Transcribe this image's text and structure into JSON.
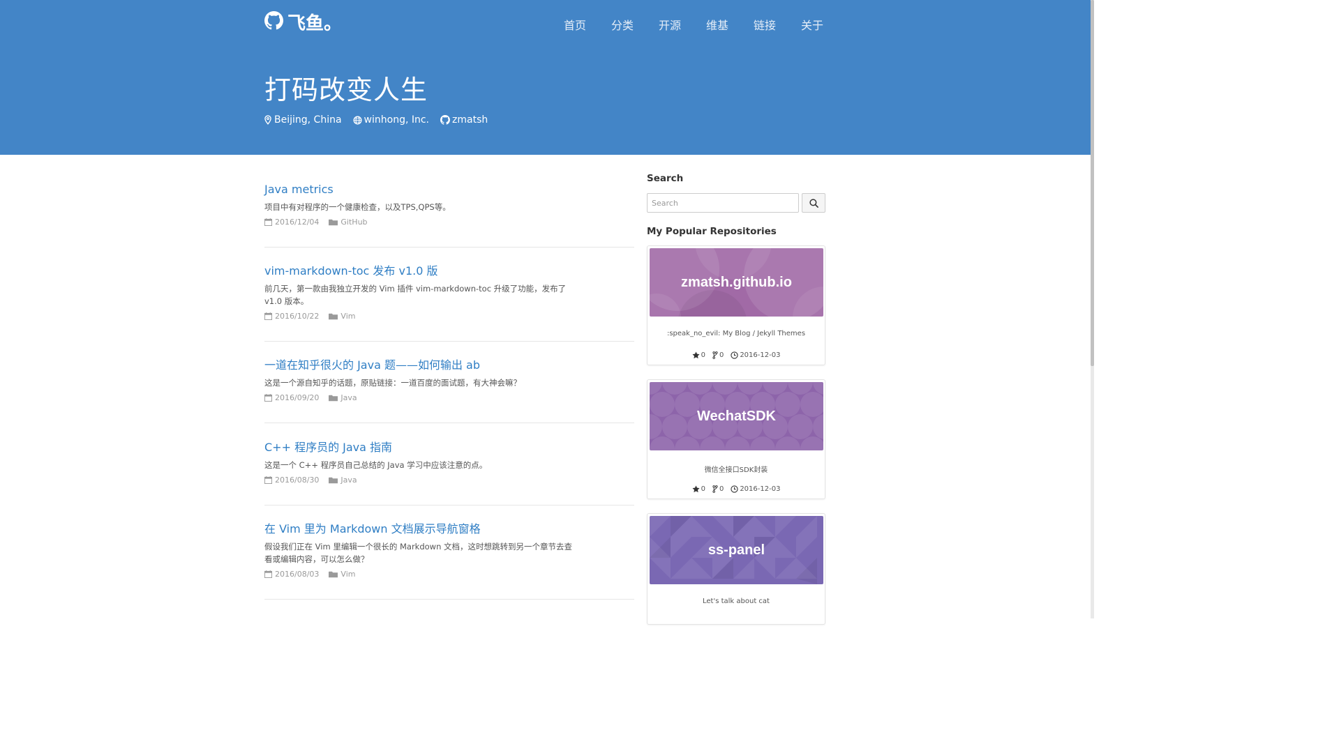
{
  "brand": {
    "name": "飞鱼。",
    "icon": "github-octocat-icon"
  },
  "nav": [
    "首页",
    "分类",
    "开源",
    "维基",
    "链接",
    "关于"
  ],
  "hero": {
    "title": "打码改变人生",
    "location": "Beijing, China",
    "company": "winhong, Inc.",
    "github": "zmatsh"
  },
  "posts": [
    {
      "title": "Java metrics",
      "excerpt": "项目中有对程序的一个健康检查，以及TPS,QPS等。",
      "date": "2016/12/04",
      "category": "GitHub"
    },
    {
      "title": "vim-markdown-toc 发布 v1.0 版",
      "excerpt": "前几天，第一款由我独立开发的 Vim 插件 vim-markdown-toc 升级了功能，发布了 v1.0 版本。",
      "date": "2016/10/22",
      "category": "Vim"
    },
    {
      "title": "一道在知乎很火的 Java 题——如何输出 ab",
      "excerpt": "这是一个源自知乎的话题，原贴链接：一道百度的面试题，有大神会嘛？",
      "date": "2016/09/20",
      "category": "Java"
    },
    {
      "title": "C++ 程序员的 Java 指南",
      "excerpt": "这是一个 C++ 程序员自己总结的 Java 学习中应该注意的点。",
      "date": "2016/08/30",
      "category": "Java"
    },
    {
      "title": "在 Vim 里为 Markdown 文档展示导航窗格",
      "excerpt": "假设我们正在 Vim 里编辑一个很长的 Markdown 文档，这时想跳转到另一个章节去查看或编辑内容，可以怎么做？",
      "date": "2016/08/03",
      "category": "Vim"
    }
  ],
  "sidebar": {
    "search_heading": "Search",
    "search_placeholder": "Search",
    "repos_heading": "My Popular Repositories"
  },
  "repos": [
    {
      "name": "zmatsh.github.io",
      "description": ":speak_no_evil: My Blog / Jekyll Themes",
      "stars": "0",
      "forks": "0",
      "updated": "2016-12-03",
      "color": "#a16aa6"
    },
    {
      "name": "WechatSDK",
      "description": "微信全接口SDK封装",
      "stars": "0",
      "forks": "0",
      "updated": "2016-12-03",
      "color": "#8d64aa"
    },
    {
      "name": "ss-panel",
      "description": "Let's talk about cat",
      "color": "#7a68b3"
    }
  ],
  "colors": {
    "header_bg": "#4385c7",
    "link": "#2f7ec4"
  }
}
